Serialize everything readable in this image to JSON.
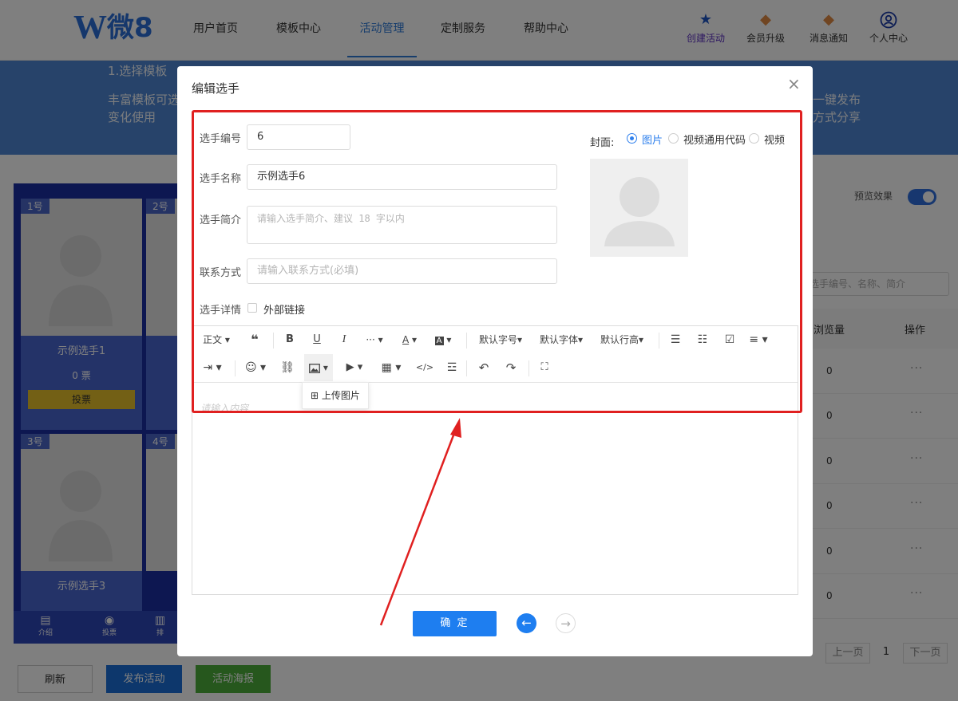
{
  "brand": {
    "logo_letter": "W",
    "logo_text": "微8"
  },
  "nav": {
    "links": [
      "用户首页",
      "模板中心",
      "活动管理",
      "定制服务",
      "帮助中心"
    ],
    "active_index": 2,
    "icons": [
      {
        "label": "创建活动",
        "icon": "star-icon"
      },
      {
        "label": "会员升级",
        "icon": "crown-icon"
      },
      {
        "label": "消息通知",
        "icon": "bell-icon"
      },
      {
        "label": "个人中心",
        "icon": "user-icon"
      }
    ]
  },
  "banner": {
    "step1_title": "1.选择模板",
    "step1_desc_l1": "丰富模板可选",
    "step1_desc_l2": "变化使用",
    "step4_desc_l1": "一键发布",
    "step4_desc_l2": "方式分享"
  },
  "preview": {
    "cards": [
      {
        "num": "1号",
        "name": "示例选手1",
        "votes": "0 票",
        "vote_btn": "投票"
      },
      {
        "num": "2号"
      },
      {
        "num": "3号",
        "name": "示例选手3"
      },
      {
        "num": "4号"
      }
    ],
    "footer": [
      "介绍",
      "投票",
      "排"
    ]
  },
  "right_panel": {
    "preview_label": "预览效果",
    "search_placeholder": "选手编号、名称、简介",
    "col_views": "浏览量",
    "col_action": "操作",
    "rows": [
      "0",
      "0",
      "0",
      "0",
      "0",
      "0"
    ],
    "more": "···",
    "pager": {
      "prev": "上一页",
      "page": "1",
      "next": "下一页"
    }
  },
  "bottom_buttons": {
    "refresh": "刷新",
    "publish": "发布活动",
    "poster": "活动海报"
  },
  "colors": {
    "primary": "#1e7ef0",
    "publish": "#1a6fd8",
    "poster": "#4caf3a",
    "highlight": "#e02020",
    "nav_active": "#2f7bd8"
  },
  "modal": {
    "title": "编辑选手",
    "close": "×",
    "fields": {
      "number_label": "选手编号",
      "number_value": "6",
      "name_label": "选手名称",
      "name_value": "示例选手6",
      "intro_label": "选手简介",
      "intro_placeholder": "请输入选手简介、建议 18 字以内",
      "contact_label": "联系方式",
      "contact_placeholder": "请输入联系方式(必填)",
      "detail_label": "选手详情",
      "external_link": "外部链接"
    },
    "cover": {
      "label": "封面:",
      "options": [
        "图片",
        "视频通用代码",
        "视频"
      ],
      "selected": "图片"
    },
    "editor": {
      "row1": {
        "paragraph": "正文",
        "quote": "❝",
        "bold": "B",
        "underline": "U",
        "italic": "I",
        "more": "···",
        "font_color": "A",
        "bg_color": "A",
        "font_size": "默认字号",
        "font_family": "默认字体",
        "line_height": "默认行高"
      },
      "placeholder": "请输入内容",
      "dropdown_item": "上传图片"
    },
    "confirm": "确 定"
  }
}
